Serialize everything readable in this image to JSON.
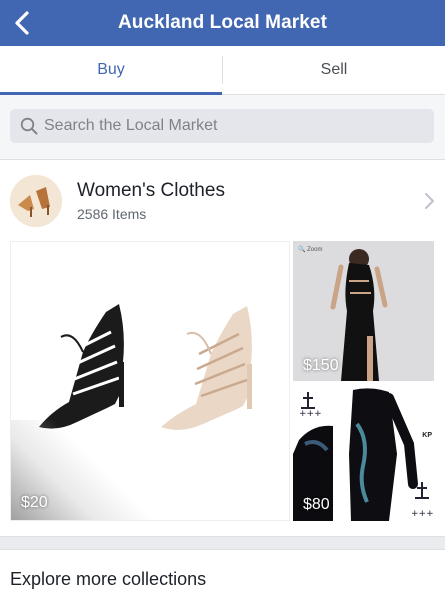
{
  "header": {
    "title": "Auckland Local Market",
    "back_icon": "chevron-left-icon",
    "bar_color": "#4267b2"
  },
  "tabs": [
    {
      "label": "Buy",
      "active": true
    },
    {
      "label": "Sell",
      "active": false
    }
  ],
  "search": {
    "placeholder": "Search the Local Market",
    "value": "",
    "icon": "search-icon"
  },
  "collection": {
    "title": "Women's Clothes",
    "count_text": "2586 Items",
    "items": [
      {
        "price": "$20",
        "subject": "lace-up heels pair"
      },
      {
        "price": "$150",
        "subject": "black dress"
      },
      {
        "price": "$80",
        "subject": "black bodysuit"
      }
    ]
  },
  "explore": {
    "label": "Explore more collections"
  }
}
